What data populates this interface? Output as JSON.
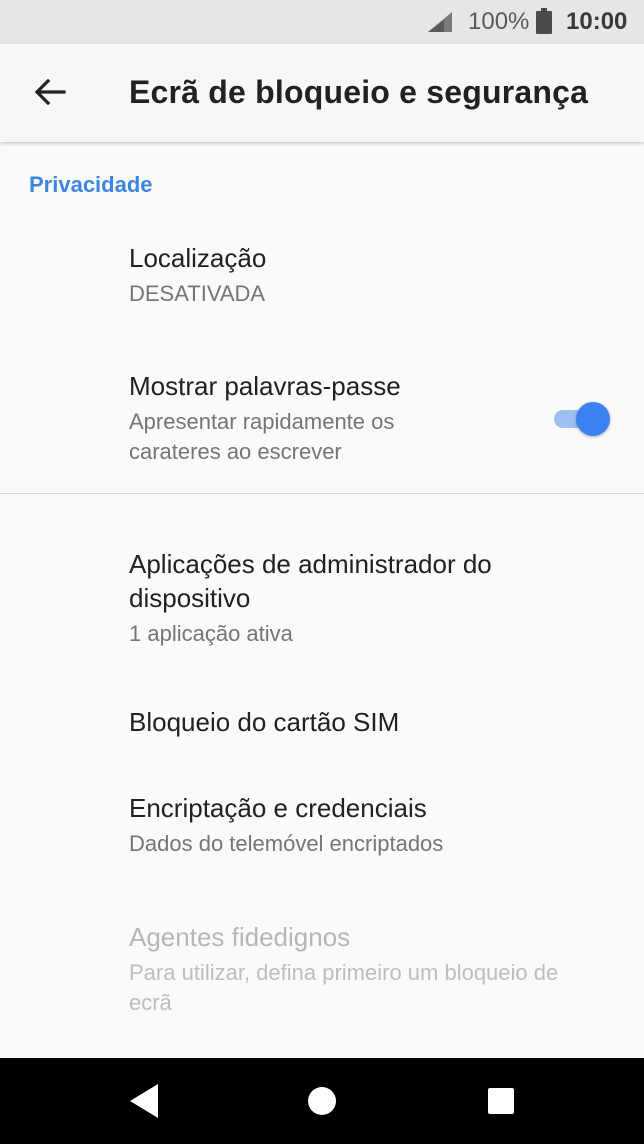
{
  "status_bar": {
    "battery_percent": "100%",
    "time": "10:00",
    "icons": [
      "signal-icon",
      "battery-icon"
    ]
  },
  "app_bar": {
    "title": "Ecrã de bloqueio e segurança",
    "back_icon": "arrow-left-icon"
  },
  "section": {
    "header": "Privacidade"
  },
  "items": [
    {
      "title": "Localização",
      "subtitle": "DESATIVADA"
    },
    {
      "title": "Mostrar palavras-passe",
      "subtitle_line1": "Apresentar rapidamente os",
      "subtitle_line2": "carateres ao escrever",
      "toggle_on": true
    },
    {
      "title_line1": "Aplicações de administrador do",
      "title_line2": "dispositivo",
      "subtitle": "1 aplicação ativa"
    },
    {
      "title": "Bloqueio do cartão SIM"
    },
    {
      "title": "Encriptação e credenciais",
      "subtitle": "Dados do telemóvel encriptados"
    },
    {
      "title": "Agentes fidedignos",
      "subtitle_line1": "Para utilizar, defina primeiro um bloqueio de",
      "subtitle_line2": "ecrã",
      "disabled": true
    }
  ],
  "colors": {
    "accent": "#3b82f0",
    "section_header": "#3d86e0",
    "toggle_track": "#9dbff2"
  },
  "nav_bar": {
    "icons": [
      "nav-back-icon",
      "nav-home-icon",
      "nav-recents-icon"
    ]
  }
}
